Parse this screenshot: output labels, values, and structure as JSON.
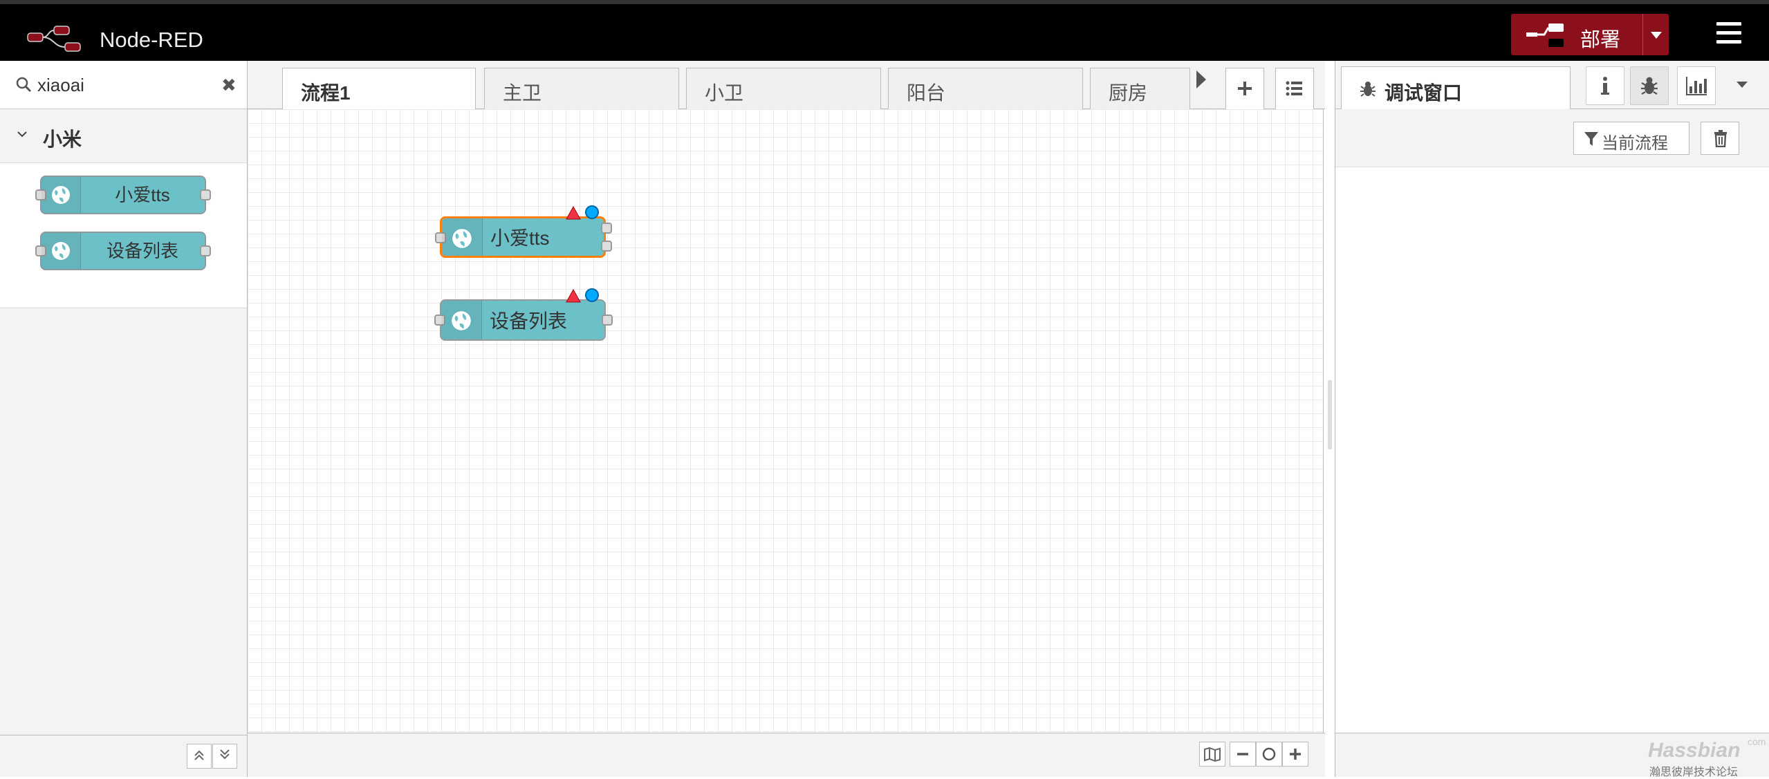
{
  "header": {
    "app_title": "Node-RED",
    "deploy_label": "部署",
    "brand_color": "#8c101c"
  },
  "palette": {
    "search": {
      "value": "xiaoai",
      "placeholder": ""
    },
    "category": {
      "label": "小米",
      "expanded": true
    },
    "nodes": [
      {
        "label": "小爱tts",
        "icon": "globe-icon",
        "color": "#6cc0c8"
      },
      {
        "label": "设备列表",
        "icon": "globe-icon",
        "color": "#6cc0c8"
      }
    ]
  },
  "workspace": {
    "tabs": [
      {
        "label": "流程1",
        "active": true
      },
      {
        "label": "主卫",
        "active": false
      },
      {
        "label": "小卫",
        "active": false
      },
      {
        "label": "阳台",
        "active": false
      },
      {
        "label": "厨房",
        "active": false
      }
    ],
    "nodes": [
      {
        "label": "小爱tts",
        "selected": true,
        "warning": true,
        "changed": true,
        "outputs": 2
      },
      {
        "label": "设备列表",
        "selected": false,
        "warning": true,
        "changed": true,
        "outputs": 1
      }
    ]
  },
  "sidebar": {
    "active_tab_label": "调试窗口",
    "tab_icons": [
      "info-icon",
      "bug-icon",
      "chart-icon"
    ],
    "filter_label": "当前流程"
  },
  "watermark": {
    "title": "Hassbian",
    "suffix": "com",
    "subtitle": "瀚思彼岸技术论坛"
  }
}
